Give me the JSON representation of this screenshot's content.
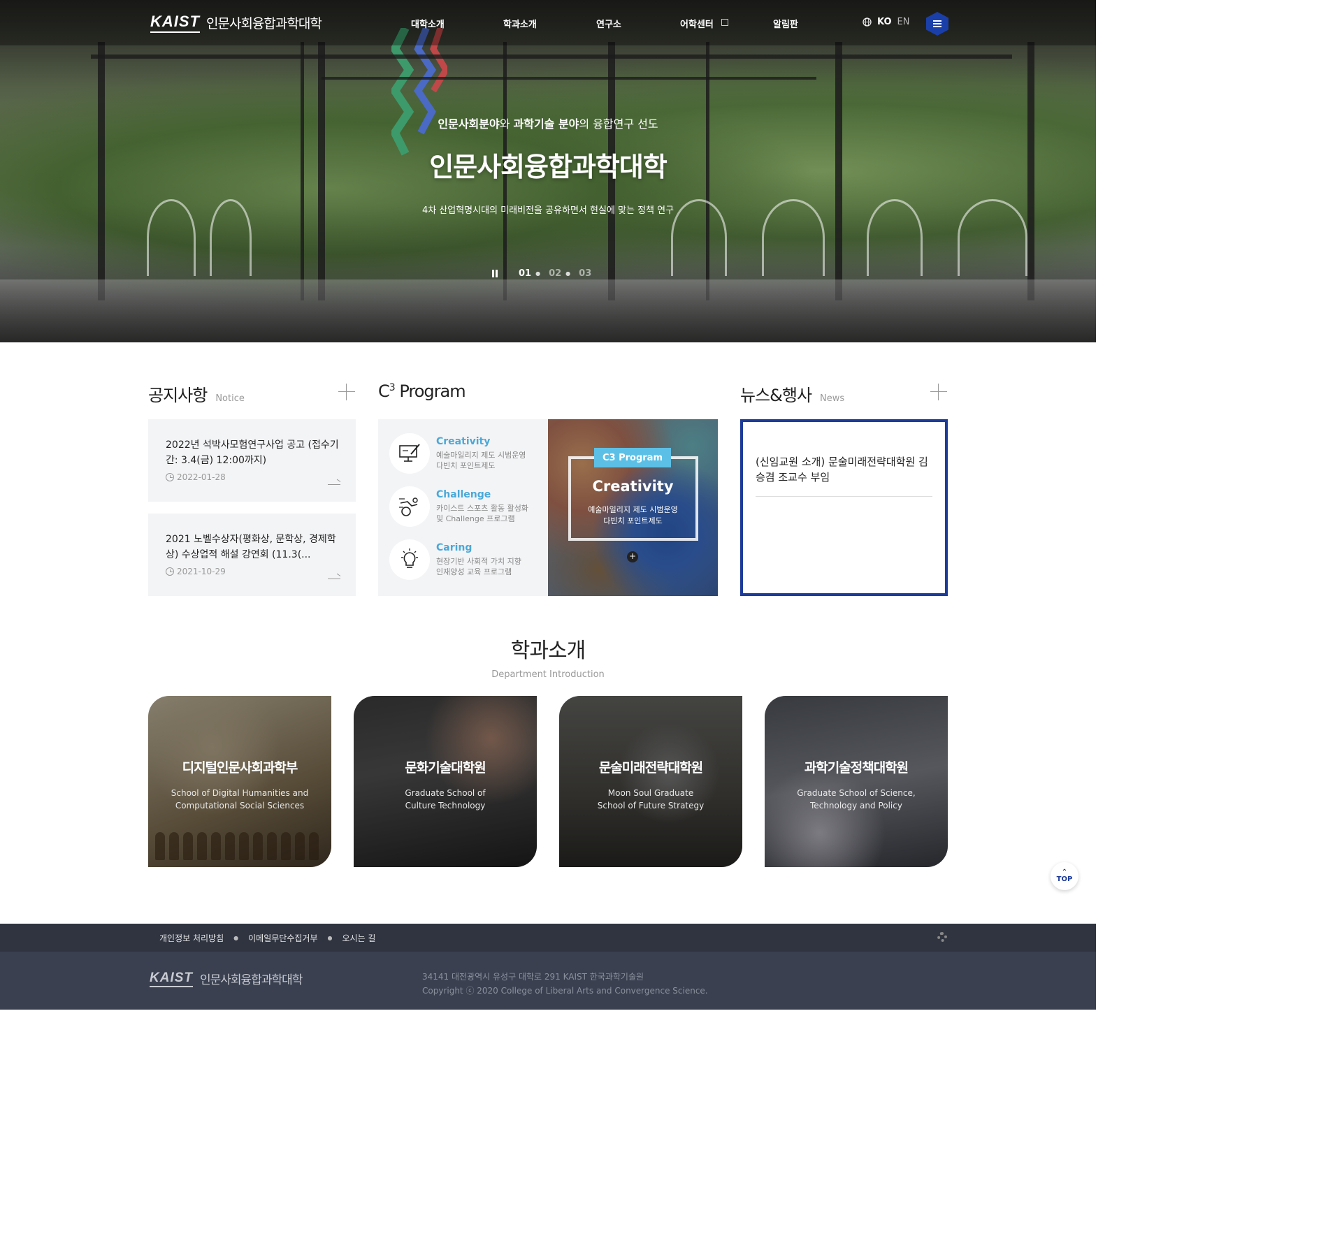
{
  "header": {
    "logo_kaist": "KAIST",
    "logo_college": "인문사회융합과학대학",
    "nav": [
      {
        "label": "대학소개"
      },
      {
        "label": "학과소개"
      },
      {
        "label": "연구소"
      },
      {
        "label": "어학센터"
      },
      {
        "label": "알림판"
      }
    ],
    "lang_ko": "KO",
    "lang_en": "EN"
  },
  "hero": {
    "sub_bold1": "인문사회분야",
    "sub_mid1": "와 ",
    "sub_bold2": "과학기술 분야",
    "sub_end": "의 융합연구 선도",
    "title": "인문사회융합과학대학",
    "desc": "4차 산업혁명시대의 미래비전을 공유하면서 현실에 맞는 정책 연구",
    "pages": [
      "01",
      "02",
      "03"
    ],
    "current_page": 1
  },
  "notice": {
    "title": "공지사항",
    "subtitle": "Notice",
    "items": [
      {
        "title": "2022년 석박사모험연구사업 공고 (접수기간: 3.4(금) 12:00까지)",
        "date": "2022-01-28"
      },
      {
        "title": "2021 노벨수상자(평화상, 문학상, 경제학상) 수상업적 해설 강연회 (11.3(...",
        "date": "2021-10-29"
      }
    ]
  },
  "c3": {
    "title_c": "C",
    "title_sup": "3",
    "title_rest": " Program",
    "items": [
      {
        "icon": "computer-edit-icon",
        "title": "Creativity",
        "desc1": "예술마일리지 제도 시범운영",
        "desc2": "다빈치 포인트제도"
      },
      {
        "icon": "sports-icon",
        "title": "Challenge",
        "desc1": "카이스트 스포츠 활동 활성화",
        "desc2": "및 Challenge 프로그램"
      },
      {
        "icon": "lightbulb-icon",
        "title": "Caring",
        "desc1": "현장기반 사회적 가치 지향",
        "desc2": "인재양성 교육 프로그램"
      }
    ],
    "slide": {
      "tag": "C3 Program",
      "title": "Creativity",
      "line1": "예술마일리지 제도 시범운영",
      "line2": "다빈치 포인트제도",
      "more": "+",
      "active_dot": 1,
      "dot_count": 3
    }
  },
  "news": {
    "title": "뉴스&행사",
    "subtitle": "News",
    "items": [
      {
        "title": "(신임교원 소개) 문술미래전략대학원 김승겸 조교수 부임"
      }
    ]
  },
  "departments": {
    "title": "학과소개",
    "subtitle": "Department Introduction",
    "items": [
      {
        "name": "디지털인문사회과학부",
        "en1": "School of Digital Humanities and",
        "en2": "Computational Social Sciences"
      },
      {
        "name": "문화기술대학원",
        "en1": "Graduate School of",
        "en2": "Culture Technology"
      },
      {
        "name": "문술미래전략대학원",
        "en1": "Moon Soul Graduate",
        "en2": "School of Future Strategy"
      },
      {
        "name": "과학기술정책대학원",
        "en1": "Graduate School of Science,",
        "en2": "Technology and Policy"
      }
    ]
  },
  "top_button": "TOP",
  "footer": {
    "links": [
      "개인정보 처리방침",
      "이메일무단수집거부",
      "오시는 길"
    ],
    "logo_kaist": "KAIST",
    "logo_college": "인문사회융합과학대학",
    "address": "34141 대전광역시 유성구 대학로 291 KAIST 한국과학기술원",
    "copyright": "Copyright ⓒ 2020 College of Liberal Arts and Convergence Science."
  },
  "colors": {
    "brand_blue": "#1d3b98",
    "accent_sky": "#4aa8d8",
    "footer_bg": "#3a4050"
  }
}
